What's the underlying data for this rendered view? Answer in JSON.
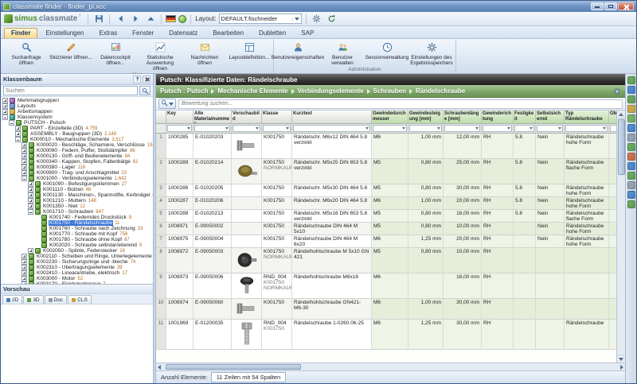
{
  "window": {
    "title": "classmate finder - finder_pi.xcc"
  },
  "brand": {
    "part1": "simus",
    "part2": "classmate",
    "sup": "³"
  },
  "toolbar": {
    "layout_label": "Layout:",
    "layout_value": "DEFAULT.fischneider"
  },
  "ribbon": {
    "tabs": [
      "Finder",
      "Einstellungen",
      "Extras",
      "Fenster",
      "Datensatz",
      "Bearbeiten",
      "Dubletten",
      "SAP"
    ],
    "active_tab": "Finder",
    "groups": [
      {
        "label": "Main",
        "buttons": [
          {
            "icon": "search-icon",
            "label": "Suchanfrage öffnen"
          },
          {
            "icon": "sketch-icon",
            "label": "Skizzierer öffnen..."
          },
          {
            "icon": "cockpit-icon",
            "label": "Datencockpit öffnen..."
          },
          {
            "icon": "stats-icon",
            "label": "Statistische Auswertung öffnen"
          },
          {
            "icon": "mail-icon",
            "label": "Nachrichten öffnen"
          },
          {
            "icon": "layoutdef-icon",
            "label": "Layoutdefinition..."
          }
        ]
      },
      {
        "label": "Administration",
        "buttons": [
          {
            "icon": "userprops-icon",
            "label": "Benutzereigenschaften"
          },
          {
            "icon": "users-icon",
            "label": "Benutzer verwalten"
          },
          {
            "icon": "session-icon",
            "label": "Sessionverwaltung"
          },
          {
            "icon": "gear-icon",
            "label": "Einstellungen des Ergebnisspeichers"
          }
        ]
      }
    ]
  },
  "sidebar": {
    "panel_title": "Klassenbaum",
    "search_placeholder": "Suchen",
    "preview_title": "Vorschau",
    "preview_tabs": [
      {
        "label": "2D",
        "color": "#4a7ab5"
      },
      {
        "label": "3D",
        "color": "#5a9e4a"
      },
      {
        "label": "Doc",
        "color": "#8a9aaa"
      },
      {
        "label": "CLS",
        "color": "#c8a03d"
      }
    ],
    "tree": [
      {
        "level": 0,
        "exp": "plus",
        "icon": "group",
        "label": "Merkmalsgruppen"
      },
      {
        "level": 0,
        "exp": "plus",
        "icon": "layout",
        "label": "Layouts"
      },
      {
        "level": 0,
        "exp": "plus",
        "icon": "workbook",
        "label": "Arbeitsmappen"
      },
      {
        "level": 0,
        "exp": "minus",
        "icon": "system",
        "label": "Klassensystem"
      },
      {
        "level": 1,
        "exp": "minus",
        "icon": "class",
        "label": "PUTSCH - Putsch"
      },
      {
        "level": 2,
        "exp": "plus",
        "icon": "class",
        "label": "PART - Einzelteile (3D)",
        "count": "4.759"
      },
      {
        "level": 2,
        "exp": "plus",
        "icon": "class",
        "label": "ASSEMBLY - Baugruppen (3D)",
        "count": "2.148"
      },
      {
        "level": 2,
        "exp": "minus",
        "icon": "class",
        "label": "K000010 - Mechanische Elemente",
        "count": "3.517"
      },
      {
        "level": 3,
        "exp": "plus",
        "icon": "class",
        "label": "K000020 - Beschläge, Scharniere, Verschlüsse",
        "count": "152"
      },
      {
        "level": 3,
        "exp": "plus",
        "icon": "class",
        "label": "K000090 - Federn, Puffer, Stoßdämpfer",
        "count": "86"
      },
      {
        "level": 3,
        "exp": "plus",
        "icon": "class",
        "label": "K000130 - Griff- und Bedienelemente",
        "count": "94"
      },
      {
        "level": 3,
        "exp": "plus",
        "icon": "class",
        "label": "K000340 - Kappen, Stopfen, Faltenbälge",
        "count": "61"
      },
      {
        "level": 3,
        "exp": "plus",
        "icon": "class",
        "label": "K000380 - Lager",
        "count": "118"
      },
      {
        "level": 3,
        "exp": "plus",
        "icon": "class",
        "label": "K000900 - Trag- und Anschlagmittel",
        "count": "23"
      },
      {
        "level": 3,
        "exp": "minus",
        "icon": "class",
        "label": "K001000 - Verbindungselemente",
        "count": "1.642"
      },
      {
        "level": 4,
        "exp": "plus",
        "icon": "class",
        "label": "K001090 - Befestigungsklemmen",
        "count": "27"
      },
      {
        "level": 4,
        "exp": "plus",
        "icon": "class",
        "label": "K001110 - Bolzen",
        "count": "48"
      },
      {
        "level": 4,
        "exp": "plus",
        "icon": "class",
        "label": "K001130 - Maschinen-, Spannstifte, Kerbnägel",
        "count": "64"
      },
      {
        "level": 4,
        "exp": "plus",
        "icon": "class",
        "label": "K001210 - Muttern",
        "count": "148"
      },
      {
        "level": 4,
        "exp": "plus",
        "icon": "class",
        "label": "K001350 - Niet",
        "count": "12"
      },
      {
        "level": 4,
        "exp": "minus",
        "icon": "class",
        "label": "K001710 - Schrauben",
        "count": "947"
      },
      {
        "level": 5,
        "exp": null,
        "icon": "class",
        "label": "K001740 - Federndes Druckstück",
        "count": "8"
      },
      {
        "level": 5,
        "exp": null,
        "icon": "class",
        "label": "K001750 - Rändelschraube",
        "count": "11",
        "selected": true
      },
      {
        "level": 5,
        "exp": null,
        "icon": "class",
        "label": "K001760 - Schraube nach Zeichnung",
        "count": "23"
      },
      {
        "level": 5,
        "exp": null,
        "icon": "class",
        "label": "K001770 - Schraube mit Kopf",
        "count": "756"
      },
      {
        "level": 5,
        "exp": null,
        "icon": "class",
        "label": "K001780 - Schraube ohne Kopf",
        "count": "87"
      },
      {
        "level": 5,
        "exp": null,
        "icon": "class",
        "label": "K002020 - Schraube selbstarretierend",
        "count": "5"
      },
      {
        "level": 4,
        "exp": "plus",
        "icon": "class",
        "label": "K002050 - Splinte, Federstecker",
        "count": "18"
      },
      {
        "level": 3,
        "exp": "plus",
        "icon": "class",
        "label": "K002110 - Scheiben und Ringe, Unterlegelemente",
        "count": "210"
      },
      {
        "level": 3,
        "exp": "plus",
        "icon": "class",
        "label": "K002230 - Sicherungsringe und -bleche",
        "count": "74"
      },
      {
        "level": 3,
        "exp": "plus",
        "icon": "class",
        "label": "K002310 - Übertragungselemente",
        "count": "39"
      },
      {
        "level": 3,
        "exp": "plus",
        "icon": "class",
        "label": "K002410 - Linearantriebe, elektrisch",
        "count": "17"
      },
      {
        "level": 3,
        "exp": "plus",
        "icon": "class",
        "label": "K003000 - Motor",
        "count": "52"
      },
      {
        "level": 3,
        "exp": "plus",
        "icon": "class",
        "label": "K003170 - Elektrokettenzug",
        "count": "7"
      }
    ]
  },
  "content": {
    "header_title": "Putsch: Klassifizierte Daten: Rändelschraube",
    "breadcrumb": [
      "Putsch : Putsch",
      "Mechanische Elemente",
      "Verbindungselemente",
      "Schrauben",
      "Rändelschraube"
    ],
    "search_placeholder": "Bewertung suchen...",
    "status_label": "Anzahl Elemente:",
    "status_value": "11 Zeilen mit 54 Spalten",
    "table": {
      "columns": [
        "Key",
        "Alte Materialnummer",
        "Vorschaubild",
        "Klasse",
        "Kurztext",
        "Gewindedurchmesser",
        "Gewindesteigung [mm]",
        "Schraubenlänge [mm]",
        "Gewinderichtung",
        "Festigkeit",
        "Selbstsichernd",
        "Typ Rändelschraube",
        "Oberflä"
      ],
      "rows": [
        {
          "num": "1",
          "key": "1000285",
          "alt": "E-01020203",
          "thumb": "screw-steel",
          "klasse": [
            "K001750"
          ],
          "kurztext": "Rändelschr. M6x12 DIN 464 5.8 verzinkt",
          "gd": "M6",
          "gs": "1,00 mm",
          "sl": "12,00 mm",
          "gr": "RH",
          "fest": "5.8",
          "selb": "Nein",
          "typ": "Rändelschraube hohe Form",
          "ober": ""
        },
        {
          "num": "2",
          "key": "1000289",
          "alt": "E-01020214",
          "thumb": "knob-olive",
          "klasse": [
            "K001750",
            "NORMKAUF"
          ],
          "kurztext": "Rändelschr. M5x25 DIN 653 5.8 verzinkt",
          "gd": "M5",
          "gs": "0,80 mm",
          "sl": "25,00 mm",
          "gr": "RH",
          "fest": "5.8",
          "selb": "Nein",
          "typ": "Rändelschraube flache Form",
          "ober": ""
        },
        {
          "num": "3",
          "key": "1000286",
          "alt": "E-01020205",
          "thumb": null,
          "klasse": [
            "K001750"
          ],
          "kurztext": "Rändelschr. M5x30 DIN 464 5.8",
          "gd": "M5",
          "gs": "0,80 mm",
          "sl": "30,00 mm",
          "gr": "RH",
          "fest": "5.8",
          "selb": "Nein",
          "typ": "Rändelschraube hohe Form",
          "ober": ""
        },
        {
          "num": "4",
          "key": "1000287",
          "alt": "E-01020206",
          "thumb": null,
          "klasse": [
            "K001750"
          ],
          "kurztext": "Rändelschr. M6x20 DIN 464 5.8",
          "gd": "M6",
          "gs": "1,00 mm",
          "sl": "20,00 mm",
          "gr": "RH",
          "fest": "5.8",
          "selb": "Nein",
          "typ": "Rändelschraube hohe Form",
          "ober": ""
        },
        {
          "num": "5",
          "key": "1000288",
          "alt": "E-01020213",
          "thumb": null,
          "klasse": [
            "K001750"
          ],
          "kurztext": "Rändelschr. M5x16 DIN 653 5.8 verzinkt",
          "gd": "M5",
          "gs": "0,80 mm",
          "sl": "16,00 mm",
          "gr": "RH",
          "fest": "5.8",
          "selb": "Nein",
          "typ": "Rändelschraube flache Form",
          "ober": ""
        },
        {
          "num": "6",
          "key": "1008971",
          "alt": "E-09050002",
          "thumb": null,
          "klasse": [
            "K001750"
          ],
          "kurztext": "Rändelschraube DIN 464 M 5x10",
          "gd": "M5",
          "gs": "0,80 mm",
          "sl": "10,00 mm",
          "gr": "RH",
          "fest": "",
          "selb": "Nein",
          "typ": "Rändelschraube hohe Form",
          "ober": ""
        },
        {
          "num": "7",
          "key": "1008975",
          "alt": "E-09050004",
          "thumb": null,
          "klasse": [
            "K001750"
          ],
          "kurztext": "Rändelschraube DIN 464 M 6x20",
          "gd": "M6",
          "gs": "1,25 mm",
          "sl": "20,00 mm",
          "gr": "RH",
          "fest": "",
          "selb": "Nein",
          "typ": "Rändelschraube hohe Form",
          "ober": ""
        },
        {
          "num": "8",
          "key": "1008972",
          "alt": "E-09050003",
          "thumb": "knob-black",
          "klasse": [
            "K001750",
            "NORMKAUF"
          ],
          "kurztext": "Rändelhohlschraube M 5x10 GN 421",
          "gd": "M5",
          "gs": "0,80 mm",
          "sl": "10,00 mm",
          "gr": "RH",
          "fest": "",
          "selb": "",
          "typ": "",
          "ober": ""
        },
        {
          "num": "9",
          "key": "1008973",
          "alt": "E-09050006",
          "thumb": "knob-black-shaft",
          "klasse": [
            "RND_004",
            "K001750",
            "NORMKAUF"
          ],
          "kurztext": "Rändelhohlschraube M6x16",
          "gd": "M6",
          "gs": "",
          "sl": "16,00 mm",
          "gr": "RH",
          "fest": "",
          "selb": "",
          "typ": "",
          "ober": ""
        },
        {
          "num": "10",
          "key": "1008974",
          "alt": "E-09050060",
          "thumb": "screw-steel",
          "klasse": [
            "K001750"
          ],
          "kurztext": "Rändelhohlschraube GN421-M6-30",
          "gd": "M6",
          "gs": "1,00 mm",
          "sl": "30,00 mm",
          "gr": "RH",
          "fest": "",
          "selb": "",
          "typ": "",
          "ober": ""
        },
        {
          "num": "11",
          "key": "1001969",
          "alt": "E-01200035",
          "thumb": "screw-large",
          "klasse": [
            "RND_004",
            "K001750"
          ],
          "kurztext": "Rändelschraube 1-0260.06-25",
          "gd": "M6",
          "gs": "1,25 mm",
          "sl": "30,00 mm",
          "gr": "RH",
          "fest": "",
          "selb": "",
          "typ": "Rändelschraube",
          "ober": ""
        }
      ]
    }
  },
  "dock_colors": [
    "#5a9e4a",
    "#3d7ec8",
    "#5a9e4a",
    "#c8a03d",
    "#6aaa58",
    "#3d7ec8",
    "#8a9aaa",
    "#5a9e4a",
    "#c8643d",
    "#3d7ec8",
    "#5a9e4a",
    "#8a9aaa",
    "#3d7ec8",
    "#5a9e4a"
  ]
}
